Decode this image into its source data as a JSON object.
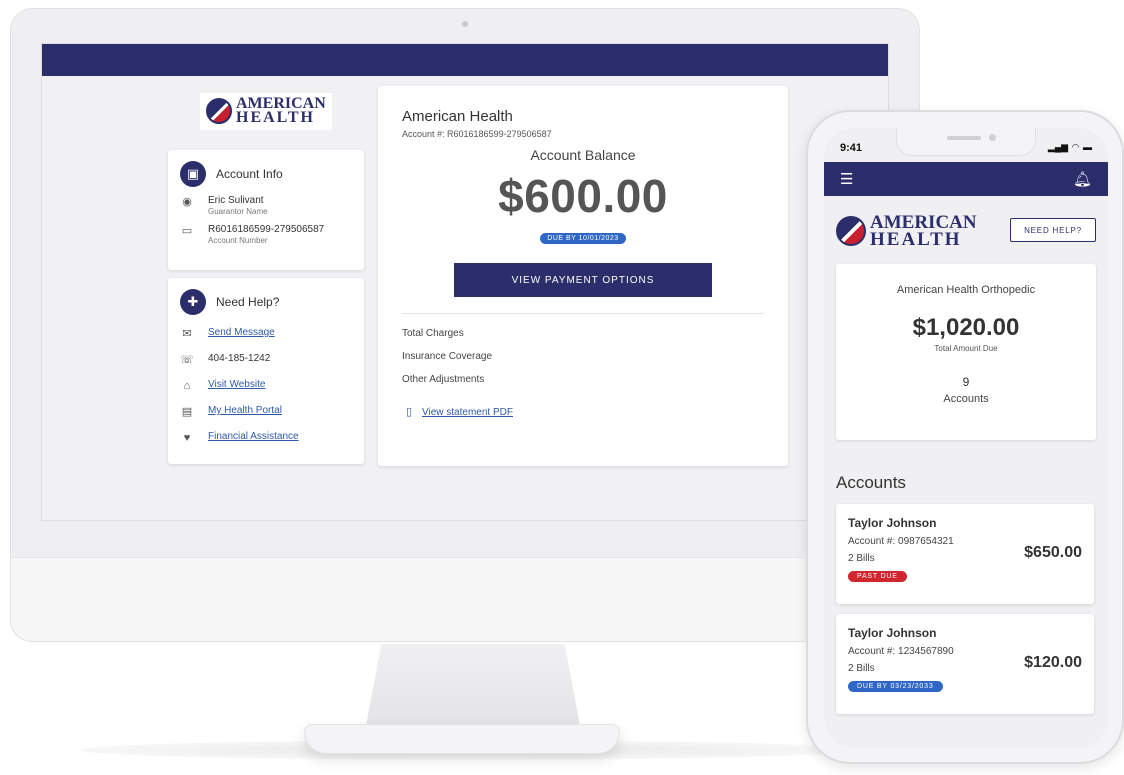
{
  "brand": {
    "name_line1": "AMERICAN",
    "name_line2": "HEALTH",
    "primary_color": "#2b2e6b",
    "accent_red": "#c8202f",
    "accent_blue": "#2f67c5"
  },
  "desktop": {
    "account_info": {
      "title": "Account Info",
      "guarantor_name": "Eric Sulivant",
      "guarantor_label": "Guarantor Name",
      "account_number": "R6016186599-279506587",
      "account_number_label": "Account Number"
    },
    "help": {
      "title": "Need Help?",
      "send_message": "Send Message",
      "phone": "404-185-1242",
      "visit_website": "Visit Website",
      "health_portal": "My Health Portal",
      "financial_assistance": "Financial Assistance"
    },
    "balance": {
      "provider": "American Health",
      "account_line": "Account #: R6016186599-279506587",
      "label": "Account Balance",
      "amount": "$600.00",
      "due": "DUE BY 10/01/2023",
      "pay_button": "VIEW PAYMENT OPTIONS",
      "line_items": [
        "Total Charges",
        "Insurance Coverage",
        "Other Adjustments"
      ],
      "pdf_link": "View statement PDF"
    }
  },
  "mobile": {
    "time": "9:41",
    "help_button": "NEED HELP?",
    "summary": {
      "provider": "American Health Orthopedic",
      "amount": "$1,020.00",
      "amount_label": "Total Amount Due",
      "count": "9",
      "count_label": "Accounts"
    },
    "accounts_heading": "Accounts",
    "accounts": [
      {
        "name": "Taylor Johnson",
        "number": "Account #: 0987654321",
        "bills": "2 Bills",
        "amount": "$650.00",
        "status": "PAST DUE",
        "status_color": "#d0262e"
      },
      {
        "name": "Taylor Johnson",
        "number": "Account #: 1234567890",
        "bills": "2 Bills",
        "amount": "$120.00",
        "status": "DUE BY 03/23/2033",
        "status_color": "#2f67c5"
      }
    ]
  }
}
